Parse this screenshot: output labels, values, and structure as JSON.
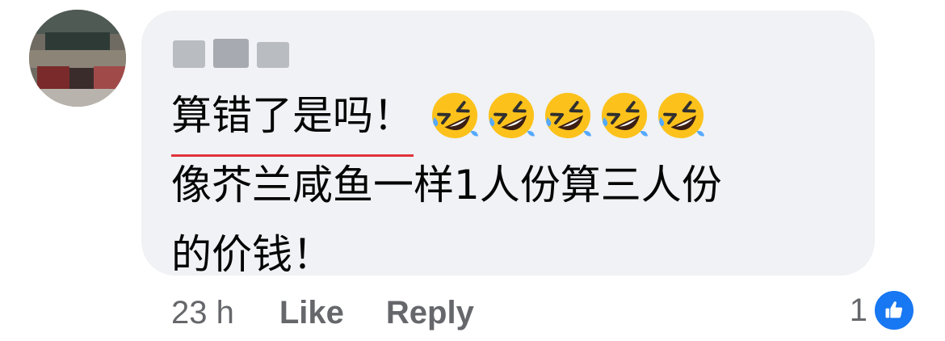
{
  "comment": {
    "author_name": "",
    "line1": "算错了是吗！",
    "line2": "像芥兰咸鱼一样1人份算三人份",
    "line3": "的价钱！",
    "emojis": [
      "rolling-on-floor-laughing",
      "rolling-on-floor-laughing",
      "rolling-on-floor-laughing",
      "rolling-on-floor-laughing",
      "rolling-on-floor-laughing"
    ]
  },
  "actions": {
    "timestamp": "23 h",
    "like_label": "Like",
    "reply_label": "Reply"
  },
  "reactions": {
    "count": "1",
    "icon": "thumbs-up-icon"
  },
  "colors": {
    "bubble": "#f0f2f5",
    "text": "#050505",
    "muted": "#65676b",
    "like_blue": "#1877f2",
    "spellcheck_red": "#e0323a"
  }
}
